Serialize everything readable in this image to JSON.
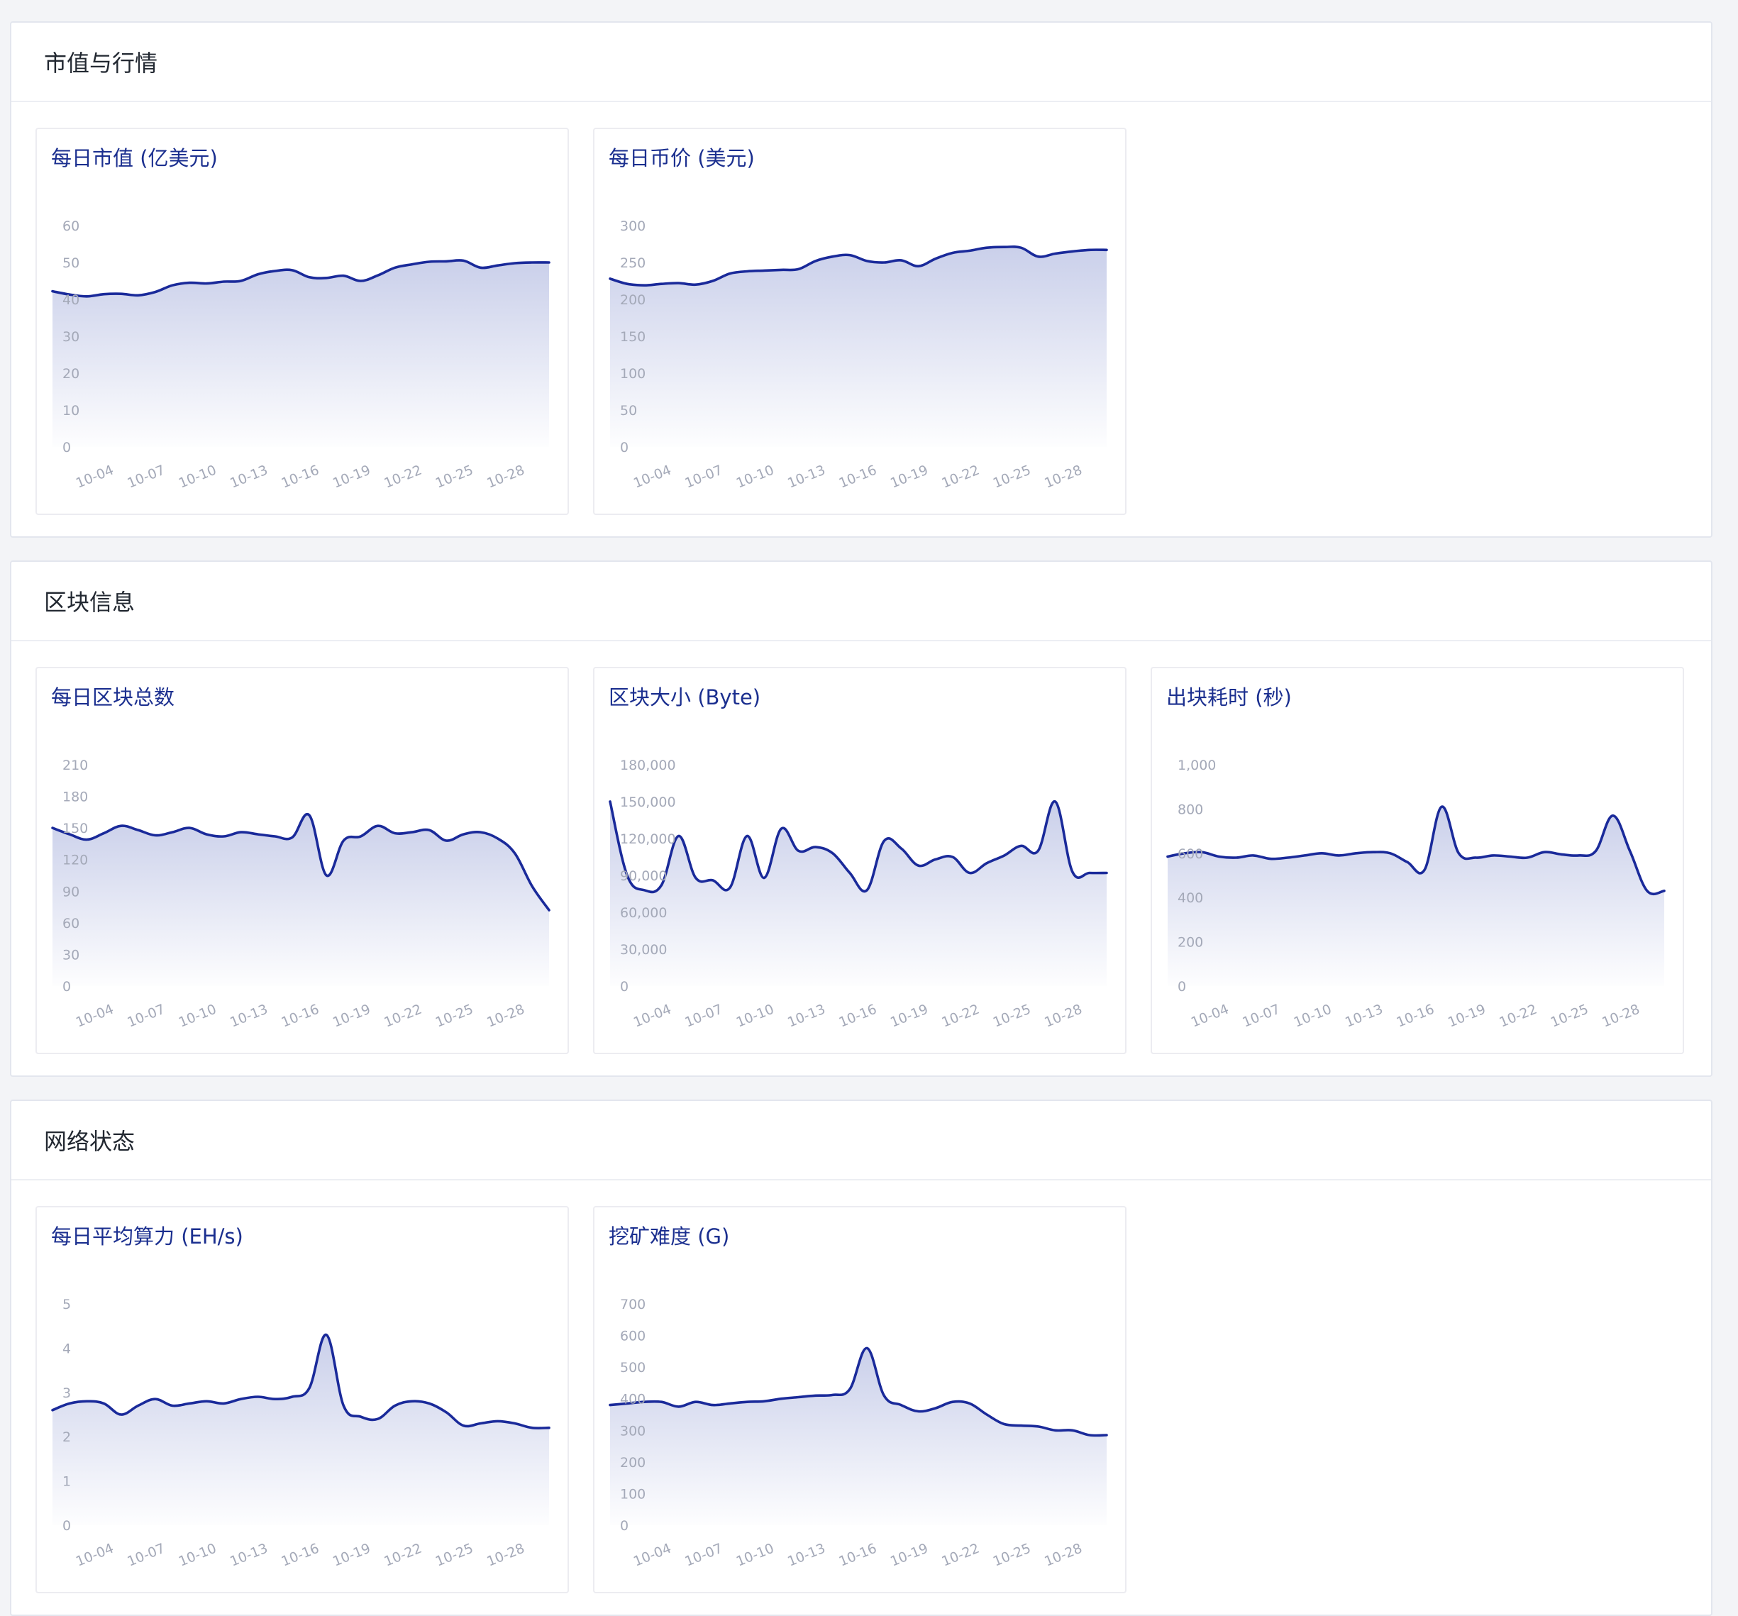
{
  "sections": [
    {
      "title": "市值与行情"
    },
    {
      "title": "区块信息"
    },
    {
      "title": "网络状态"
    }
  ],
  "colors": {
    "line": "#1a2a9a",
    "area_top": "#c7cde9",
    "title": "#1b2f8f"
  },
  "x_dates": [
    "10-02",
    "10-03",
    "10-04",
    "10-05",
    "10-06",
    "10-07",
    "10-08",
    "10-09",
    "10-10",
    "10-11",
    "10-12",
    "10-13",
    "10-14",
    "10-15",
    "10-16",
    "10-17",
    "10-18",
    "10-19",
    "10-20",
    "10-21",
    "10-22",
    "10-23",
    "10-24",
    "10-25",
    "10-26",
    "10-27",
    "10-28",
    "10-29",
    "10-30",
    "10-31"
  ],
  "x_tick_labels": [
    "10-04",
    "10-07",
    "10-10",
    "10-13",
    "10-16",
    "10-19",
    "10-22",
    "10-25",
    "10-28"
  ],
  "chart_data": [
    {
      "type": "area",
      "title": "每日市值 (亿美元)",
      "ylim": [
        0,
        60
      ],
      "yticks": [
        "0",
        "10",
        "20",
        "30",
        "40",
        "50",
        "60"
      ],
      "grid": false,
      "values": [
        42.2,
        41.3,
        40.8,
        41.4,
        41.5,
        41.1,
        42.0,
        43.8,
        44.5,
        44.3,
        44.8,
        45.0,
        46.8,
        47.7,
        47.9,
        46.0,
        45.8,
        46.4,
        45.0,
        46.5,
        48.6,
        49.5,
        50.2,
        50.3,
        50.5,
        48.6,
        49.2,
        49.8,
        50.0,
        50.0
      ]
    },
    {
      "type": "area",
      "title": "每日币价 (美元)",
      "ylim": [
        0,
        300
      ],
      "yticks": [
        "0",
        "50",
        "100",
        "150",
        "200",
        "250",
        "300"
      ],
      "grid": false,
      "values": [
        228,
        221,
        219,
        221,
        222,
        220,
        225,
        235,
        238,
        239,
        240,
        241,
        252,
        258,
        260,
        252,
        250,
        253,
        245,
        255,
        263,
        266,
        270,
        271,
        270,
        258,
        262,
        265,
        267,
        267
      ]
    },
    {
      "type": "area",
      "title": "每日区块总数",
      "ylim": [
        0,
        210
      ],
      "yticks": [
        "0",
        "30",
        "60",
        "90",
        "120",
        "150",
        "180",
        "210"
      ],
      "grid": false,
      "values": [
        150,
        144,
        139,
        145,
        152,
        148,
        143,
        146,
        150,
        144,
        142,
        146,
        144,
        142,
        141,
        162,
        105,
        138,
        142,
        152,
        145,
        146,
        148,
        138,
        144,
        146,
        140,
        126,
        95,
        72
      ]
    },
    {
      "type": "area",
      "title": "区块大小 (Byte)",
      "ylim": [
        0,
        180000
      ],
      "yticks": [
        "0",
        "30,000",
        "60,000",
        "90,000",
        "120,000",
        "150,000",
        "180,000"
      ],
      "grid": false,
      "values": [
        150000,
        90000,
        78000,
        82000,
        122000,
        88000,
        86000,
        80000,
        122000,
        88000,
        128000,
        110000,
        113000,
        108000,
        92000,
        78000,
        118000,
        112000,
        98000,
        103000,
        105000,
        92000,
        100000,
        106000,
        114000,
        110000,
        150000,
        93000,
        92000,
        92000
      ]
    },
    {
      "type": "area",
      "title": "出块耗时 (秒)",
      "ylim": [
        0,
        1000
      ],
      "yticks": [
        "0",
        "200",
        "400",
        "600",
        "800",
        "1,000"
      ],
      "grid": false,
      "values": [
        585,
        600,
        605,
        585,
        580,
        590,
        575,
        580,
        590,
        600,
        590,
        600,
        605,
        600,
        560,
        525,
        810,
        600,
        580,
        590,
        585,
        580,
        605,
        595,
        590,
        610,
        770,
        610,
        430,
        430
      ]
    },
    {
      "type": "area",
      "title": "每日平均算力 (EH/s)",
      "ylim": [
        0,
        5
      ],
      "yticks": [
        "0",
        "1",
        "2",
        "3",
        "4",
        "5"
      ],
      "grid": false,
      "values": [
        2.6,
        2.75,
        2.8,
        2.75,
        2.5,
        2.7,
        2.85,
        2.7,
        2.75,
        2.8,
        2.75,
        2.85,
        2.9,
        2.85,
        2.9,
        3.1,
        4.3,
        2.7,
        2.45,
        2.4,
        2.7,
        2.8,
        2.75,
        2.55,
        2.25,
        2.3,
        2.35,
        2.3,
        2.2,
        2.2
      ]
    },
    {
      "type": "area",
      "title": "挖矿难度 (G)",
      "ylim": [
        0,
        700
      ],
      "yticks": [
        "0",
        "100",
        "200",
        "300",
        "400",
        "500",
        "600",
        "700"
      ],
      "grid": false,
      "values": [
        380,
        385,
        390,
        390,
        375,
        390,
        380,
        385,
        390,
        392,
        400,
        405,
        410,
        412,
        430,
        560,
        410,
        380,
        360,
        370,
        390,
        385,
        350,
        320,
        315,
        312,
        300,
        300,
        285,
        285
      ]
    }
  ]
}
